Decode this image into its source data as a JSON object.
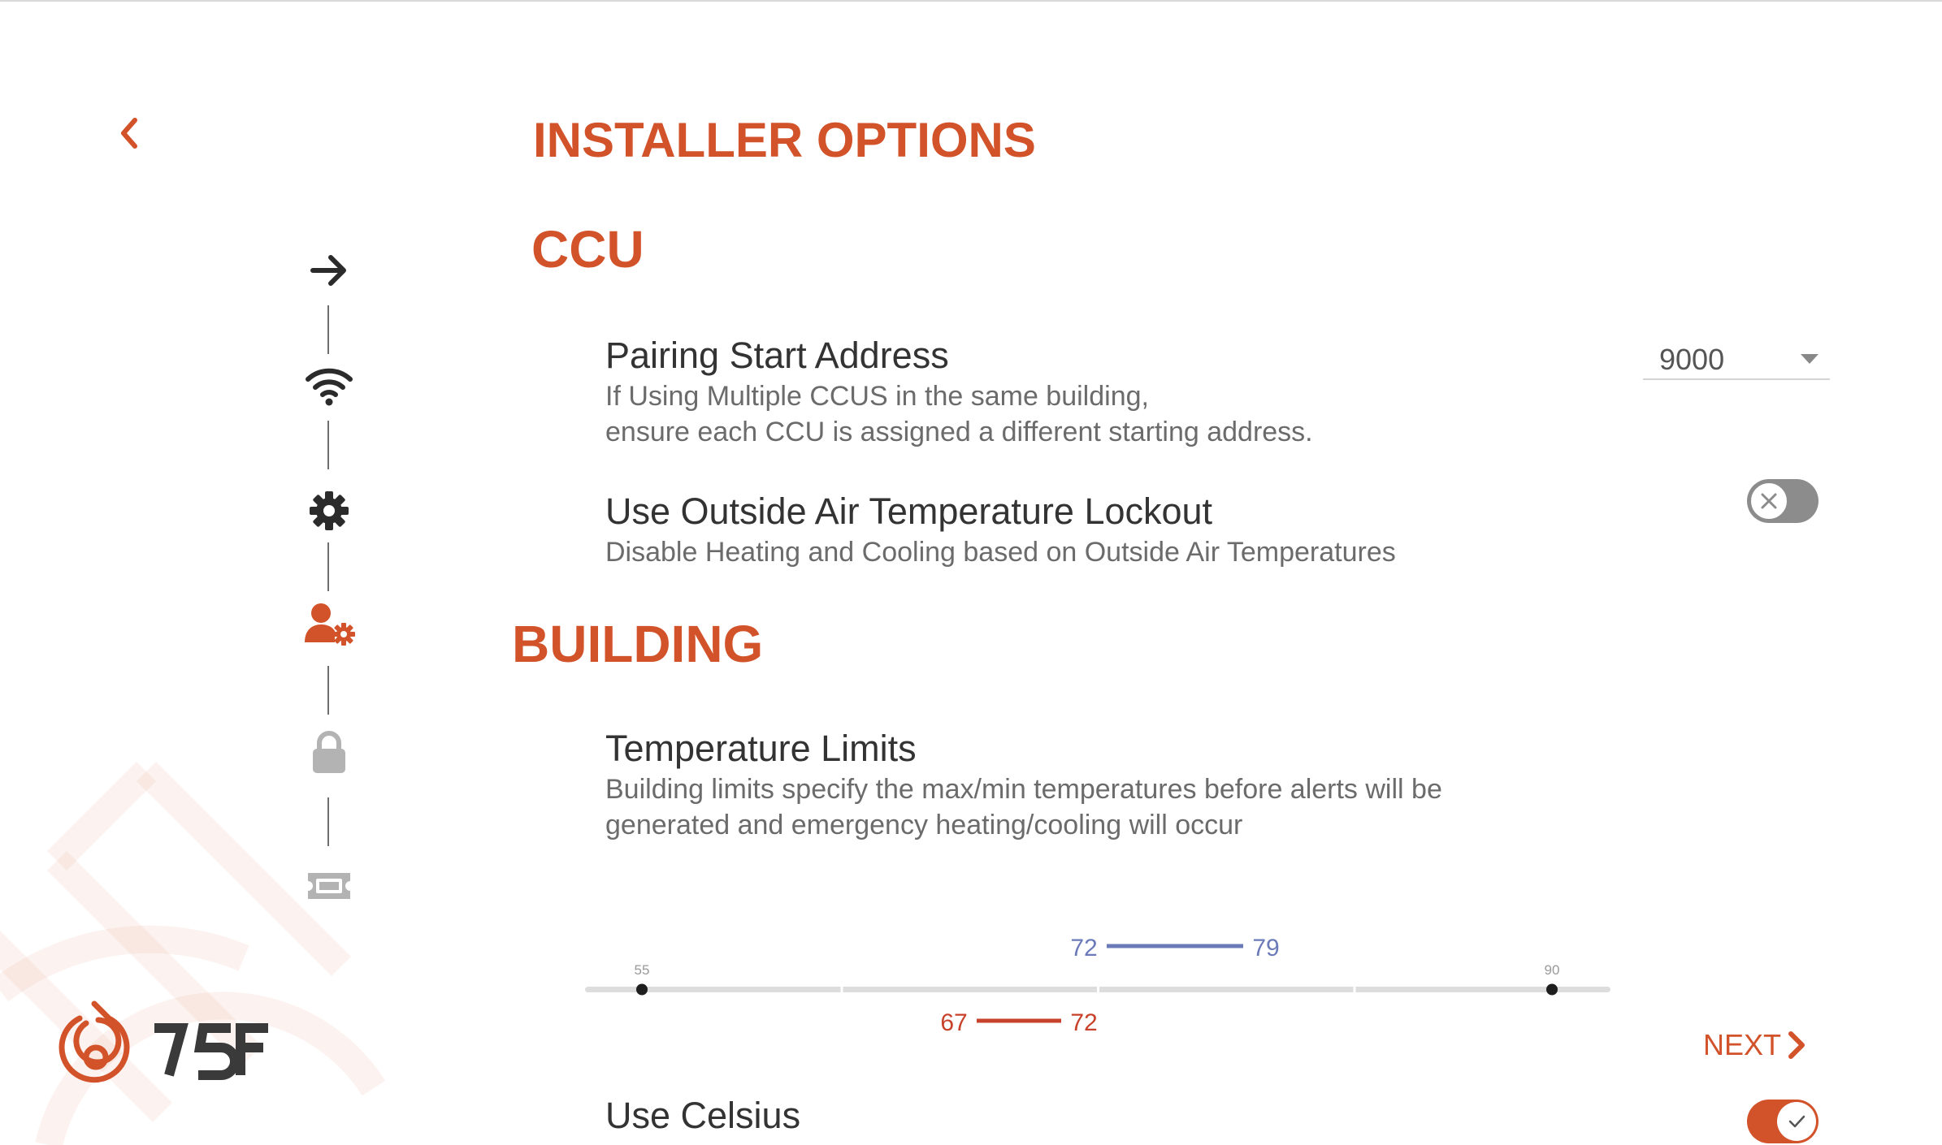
{
  "page": {
    "title": "INSTALLER OPTIONS",
    "back_icon": "chevron-left-icon"
  },
  "brand": {
    "logo_text": "75F",
    "accent_color": "#d2522a"
  },
  "steps": [
    {
      "icon": "arrow-right-icon",
      "state": "done"
    },
    {
      "icon": "wifi-icon",
      "state": "done"
    },
    {
      "icon": "gear-icon",
      "state": "done"
    },
    {
      "icon": "user-gear-icon",
      "state": "active"
    },
    {
      "icon": "lock-icon",
      "state": "pending"
    },
    {
      "icon": "ticket-icon",
      "state": "pending"
    }
  ],
  "ccu": {
    "heading": "CCU",
    "pairing": {
      "title": "Pairing Start Address",
      "desc_line1": "If Using Multiple CCUS in the same building,",
      "desc_line2": "ensure each CCU is assigned a different starting address.",
      "selected_value": "9000"
    },
    "oat_lockout": {
      "title": "Use Outside Air Temperature Lockout",
      "desc": "Disable Heating and Cooling based on Outside Air Temperatures",
      "enabled": false
    }
  },
  "building": {
    "heading": "BUILDING",
    "temp_limits": {
      "title": "Temperature Limits",
      "desc_line1": "Building limits specify the max/min temperatures before alerts will be",
      "desc_line2": "generated and emergency heating/cooling will occur",
      "range_min": 55,
      "range_max": 90,
      "range_min_label": "55",
      "range_max_label": "90",
      "cooling": {
        "low": 72,
        "high": 79,
        "low_label": "72",
        "high_label": "79",
        "color": "#6b7ab8"
      },
      "heating": {
        "low": 67,
        "high": 72,
        "low_label": "67",
        "high_label": "72",
        "color": "#c8412a"
      }
    }
  },
  "next": {
    "label": "NEXT"
  },
  "celsius": {
    "title": "Use Celsius",
    "enabled": true
  }
}
